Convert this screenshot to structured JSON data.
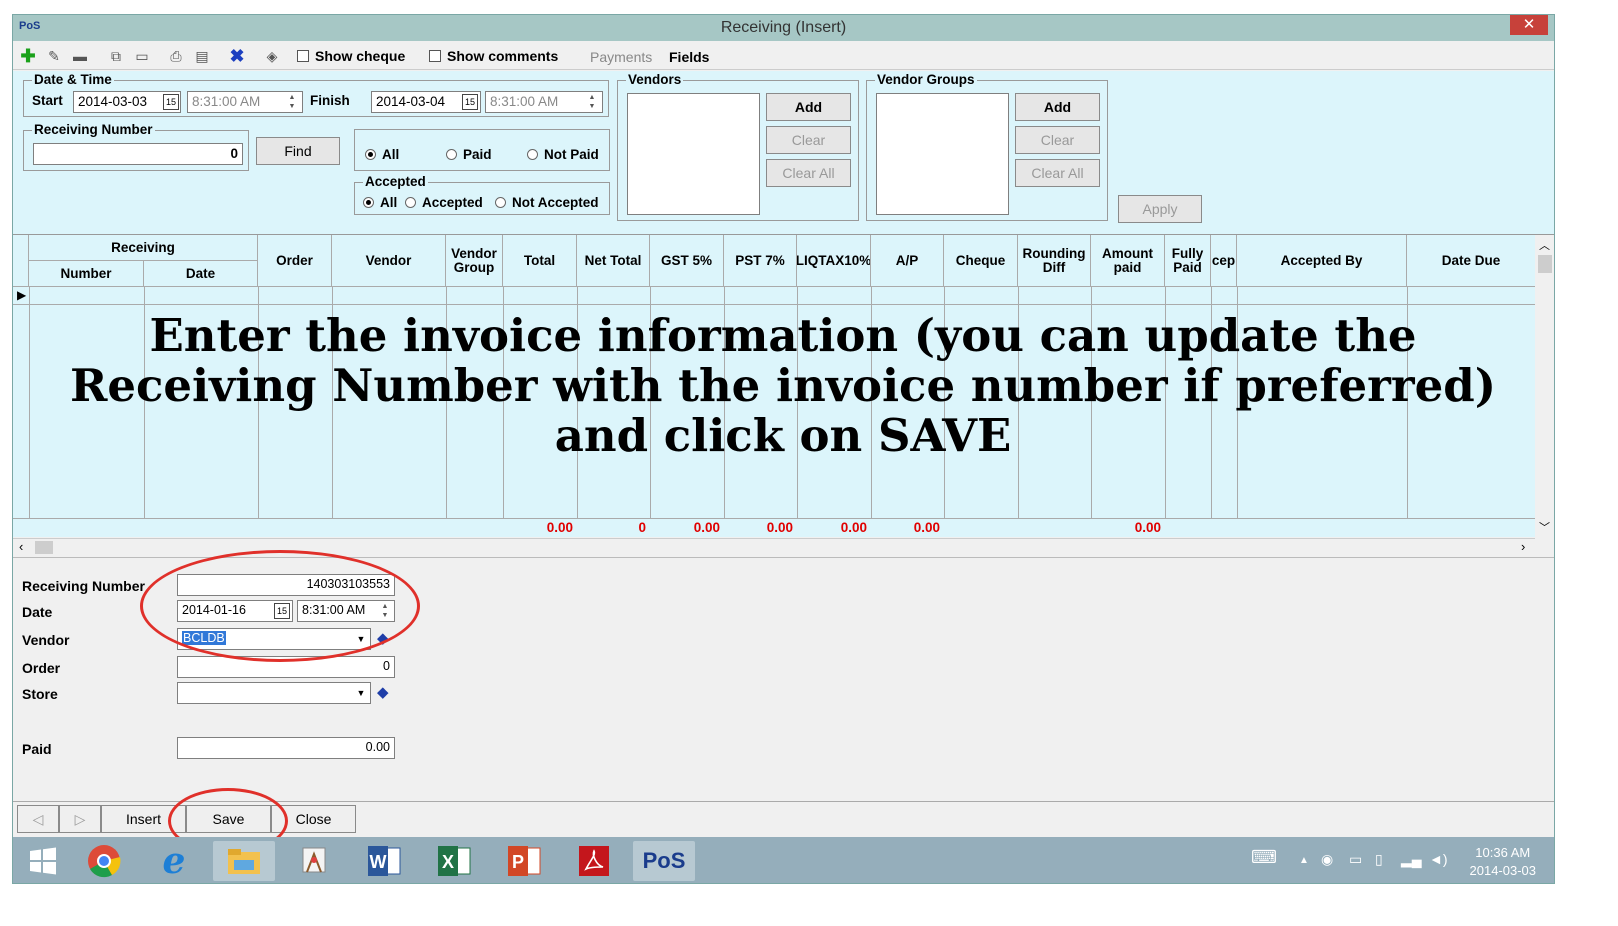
{
  "window": {
    "app_icon": "PoS",
    "title": "Receiving (Insert)",
    "close": "✕"
  },
  "toolbar": {
    "icons": [
      "add-icon",
      "edit-icon",
      "remove-icon",
      "preview-icon",
      "window-icon",
      "print-icon",
      "export-icon",
      "delete-icon",
      "clear-icon"
    ],
    "show_cheque": "Show cheque",
    "show_comments": "Show comments",
    "payments": "Payments",
    "fields": "Fields"
  },
  "filter": {
    "date_time": {
      "legend": "Date & Time",
      "start_label": "Start",
      "start_date": "2014-03-03",
      "start_time": "8:31:00 AM",
      "finish_label": "Finish",
      "finish_date": "2014-03-04",
      "finish_time": "8:31:00 AM"
    },
    "receiving_number": {
      "legend": "Receiving Number",
      "value": "0",
      "find": "Find"
    },
    "paid": {
      "all": "All",
      "paid": "Paid",
      "not_paid": "Not Paid",
      "selected": "All"
    },
    "accepted": {
      "legend": "Accepted",
      "all": "All",
      "accepted": "Accepted",
      "not_accepted": "Not Accepted",
      "selected": "All"
    },
    "vendors": {
      "legend": "Vendors",
      "add": "Add",
      "clear": "Clear",
      "clear_all": "Clear All"
    },
    "vendor_groups": {
      "legend": "Vendor Groups",
      "add": "Add",
      "clear": "Clear",
      "clear_all": "Clear All"
    },
    "apply": "Apply"
  },
  "grid": {
    "group_header": "Receiving",
    "columns": [
      "Number",
      "Date",
      "Order",
      "Vendor",
      "Vendor Group",
      "Total",
      "Net Total",
      "GST 5%",
      "PST 7%",
      "LIQTAX10%",
      "A/P",
      "Cheque",
      "Rounding Diff",
      "Amount paid",
      "Fully Paid",
      "cep",
      "Accepted By",
      "Date Due"
    ],
    "totals": {
      "total": "0.00",
      "net_total": "0",
      "gst": "0.00",
      "pst": "0.00",
      "liqtax": "0.00",
      "ap": "0.00",
      "amount_paid": "0.00"
    }
  },
  "overlay_text": [
    "Enter the invoice information (you can update the",
    "Receiving Number with the invoice number if preferred)",
    "and click on SAVE"
  ],
  "detail": {
    "receiving_number_label": "Receiving Number",
    "receiving_number": "140303103553",
    "date_label": "Date",
    "date": "2014-01-16",
    "time": "8:31:00 AM",
    "vendor_label": "Vendor",
    "vendor": "BCLDB",
    "order_label": "Order",
    "order": "0",
    "store_label": "Store",
    "store": "",
    "paid_label": "Paid",
    "paid": "0.00"
  },
  "buttons": {
    "prev": "◁",
    "next": "▷",
    "insert": "Insert",
    "save": "Save",
    "close": "Close"
  },
  "taskbar": {
    "apps": [
      "windows-start",
      "chrome",
      "internet-explorer",
      "file-explorer",
      "paint",
      "word",
      "excel",
      "powerpoint",
      "acrobat",
      "pos"
    ],
    "pos_label": "PoS",
    "time": "10:36 AM",
    "date": "2014-03-03"
  }
}
